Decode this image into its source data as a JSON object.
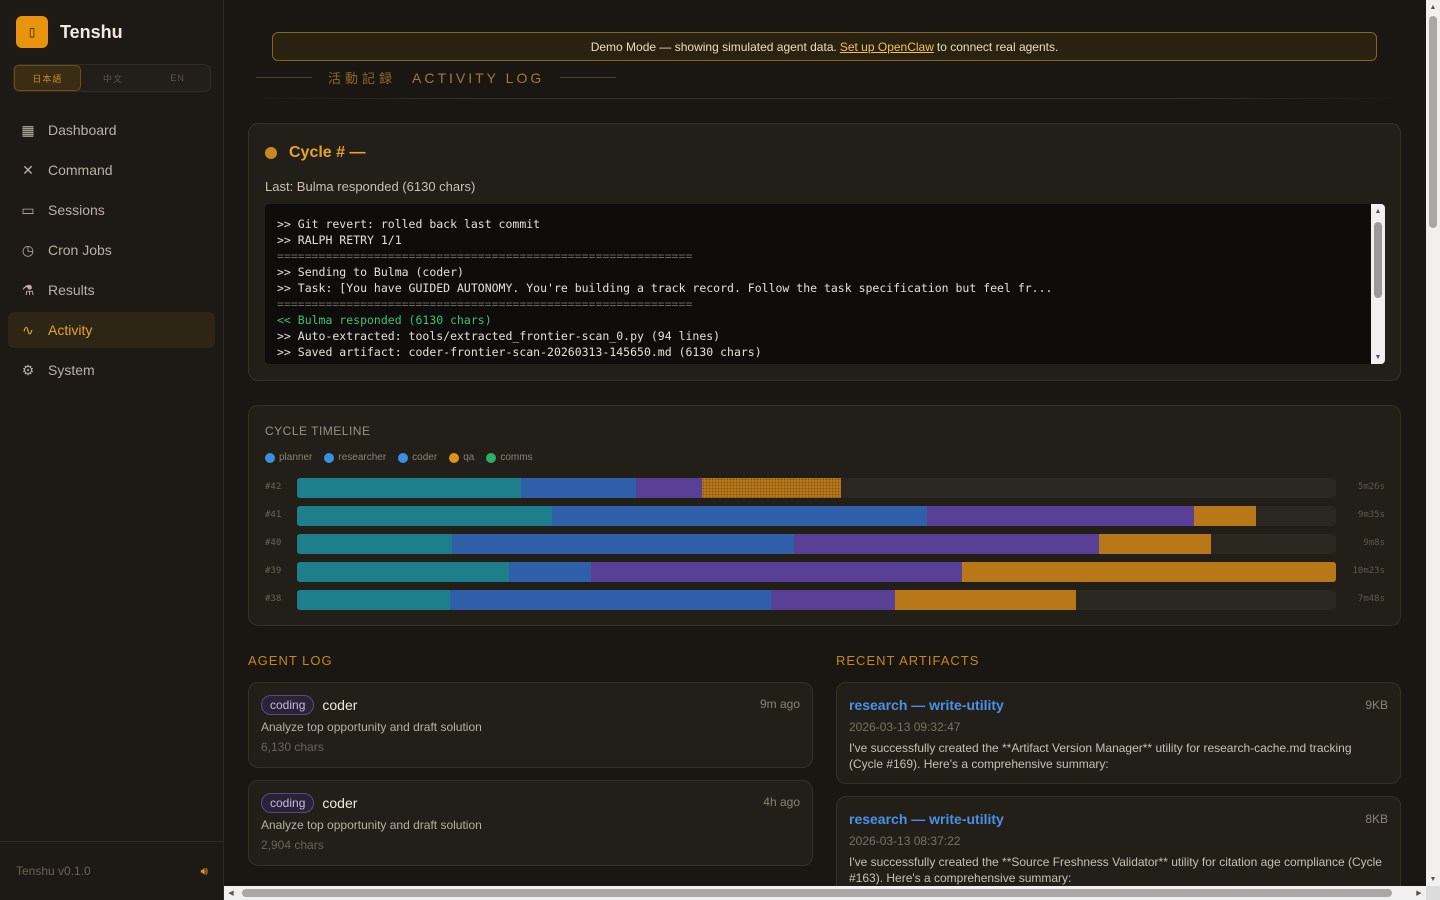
{
  "brand": {
    "name": "Tenshu",
    "logo_icon": "castle-icon"
  },
  "lang_switch": [
    "日本語",
    "中文",
    "EN"
  ],
  "nav": [
    {
      "label": "Dashboard",
      "icon": "grid-icon",
      "glyph": "▦",
      "active": false
    },
    {
      "label": "Command",
      "icon": "crossed-swords-icon",
      "glyph": "✕",
      "active": false
    },
    {
      "label": "Sessions",
      "icon": "monitor-icon",
      "glyph": "▭",
      "active": false
    },
    {
      "label": "Cron Jobs",
      "icon": "clock-icon",
      "glyph": "◷",
      "active": false
    },
    {
      "label": "Results",
      "icon": "flask-icon",
      "glyph": "⚗",
      "active": false
    },
    {
      "label": "Activity",
      "icon": "activity-icon",
      "glyph": "∿",
      "active": true
    },
    {
      "label": "System",
      "icon": "gear-icon",
      "glyph": "⚙",
      "active": false
    }
  ],
  "footer": {
    "version": "Tenshu v0.1.0",
    "sound_icon": "speaker-icon"
  },
  "banner": {
    "before": "Demo Mode — showing simulated agent data.",
    "link": "Set up OpenClaw",
    "after": "to connect real agents."
  },
  "heading": {
    "jp": "活動記録",
    "en": "ACTIVITY LOG"
  },
  "cycle": {
    "title": "Cycle # —",
    "last": "Last: Bulma responded (6130 chars)",
    "lines": [
      {
        "text": ">> Git revert: rolled back last commit",
        "style": ""
      },
      {
        "text": ">> RALPH RETRY 1/1",
        "style": ""
      },
      {
        "text": "============================================================",
        "style": "dim"
      },
      {
        "text": ">> Sending to Bulma (coder)",
        "style": ""
      },
      {
        "text": ">> Task: [You have GUIDED AUTONOMY. You're building a track record. Follow the task specification but feel fr...",
        "style": ""
      },
      {
        "text": "============================================================",
        "style": "dim"
      },
      {
        "text": "<< Bulma responded (6130 chars)",
        "style": "green"
      },
      {
        "text": ">> Auto-extracted: tools/extracted_frontier-scan_0.py (94 lines)",
        "style": ""
      },
      {
        "text": ">> Saved artifact: coder-frontier-scan-20260313-145650.md (6130 chars)",
        "style": ""
      }
    ]
  },
  "timeline": {
    "title": "CYCLE TIMELINE",
    "legend": [
      {
        "name": "planner",
        "color": "#3a8fe0"
      },
      {
        "name": "researcher",
        "color": "#3a8fe0"
      },
      {
        "name": "coder",
        "color": "#3a8fe0"
      },
      {
        "name": "qa",
        "color": "#e0931a"
      },
      {
        "name": "comms",
        "color": "#28b06a"
      }
    ],
    "rows": [
      {
        "label": "#42",
        "duration": "5m26s",
        "segments": [
          0.216,
          0.11,
          0.064,
          0.134
        ]
      },
      {
        "label": "#41",
        "duration": "9m35s",
        "segments": [
          0.245,
          0.361,
          0.257,
          0.06
        ]
      },
      {
        "label": "#40",
        "duration": "9m8s",
        "segments": [
          0.149,
          0.329,
          0.294,
          0.108
        ]
      },
      {
        "label": "#39",
        "duration": "10m23s",
        "segments": [
          0.204,
          0.079,
          0.357,
          0.36
        ]
      },
      {
        "label": "#38",
        "duration": "7m48s",
        "segments": [
          0.147,
          0.309,
          0.12,
          0.174
        ]
      }
    ],
    "segment_colors": [
      "#1e7f8c",
      "#2f5fa8",
      "#5a3f96",
      "#b87818"
    ]
  },
  "agent_log": {
    "title": "AGENT LOG",
    "items": [
      {
        "tag": "coding",
        "agent": "coder",
        "time": "9m ago",
        "desc": "Analyze top opportunity and draft solution",
        "chars": "6,130 chars"
      },
      {
        "tag": "coding",
        "agent": "coder",
        "time": "4h ago",
        "desc": "Analyze top opportunity and draft solution",
        "chars": "2,904 chars"
      }
    ]
  },
  "artifacts": {
    "title": "RECENT ARTIFACTS",
    "items": [
      {
        "title": "research — write-utility",
        "size": "9KB",
        "date": "2026-03-13 09:32:47",
        "summary": "I've successfully created the **Artifact Version Manager** utility for research-cache.md tracking (Cycle #169). Here's a comprehensive summary:"
      },
      {
        "title": "research — write-utility",
        "size": "8KB",
        "date": "2026-03-13 08:37:22",
        "summary": "I've successfully created the **Source Freshness Validator** utility for citation age compliance (Cycle #163). Here's a comprehensive summary:"
      }
    ]
  }
}
